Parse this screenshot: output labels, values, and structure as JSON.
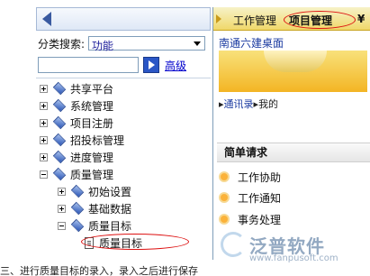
{
  "left_panel": {
    "search_label": "分类搜索:",
    "category_value": "功能",
    "keyword_value": "",
    "advanced_label": "高级",
    "tree": [
      {
        "label": "共享平台",
        "level": 0,
        "expand": "plus",
        "icon": "folder-icon"
      },
      {
        "label": "系统管理",
        "level": 0,
        "expand": "plus",
        "icon": "folder-icon"
      },
      {
        "label": "项目注册",
        "level": 0,
        "expand": "plus",
        "icon": "folder-icon"
      },
      {
        "label": "招投标管理",
        "level": 0,
        "expand": "plus",
        "icon": "folder-icon"
      },
      {
        "label": "进度管理",
        "level": 0,
        "expand": "plus",
        "icon": "folder-icon"
      },
      {
        "label": "质量管理",
        "level": 0,
        "expand": "minus",
        "icon": "folder-icon"
      },
      {
        "label": "初始设置",
        "level": 1,
        "expand": "plus",
        "icon": "folder-icon"
      },
      {
        "label": "基础数据",
        "level": 1,
        "expand": "plus",
        "icon": "folder-icon"
      },
      {
        "label": "质量目标",
        "level": 1,
        "expand": "minus",
        "icon": "folder-icon"
      },
      {
        "label": "质量目标",
        "level": 2,
        "expand": "none",
        "icon": "document-icon"
      }
    ]
  },
  "right_panel": {
    "tabs": [
      "工作管理",
      "项目管理"
    ],
    "tab_more": "¥",
    "desktop_title": "南通六建桌面",
    "contacts_link": "通讯录",
    "contacts_rest": "我的",
    "simple_request_title": "简单请求",
    "simple_items": [
      "工作协助",
      "工作通知",
      "事务处理"
    ]
  },
  "watermark": {
    "brand": "泛普软件",
    "url": "www.fanpusoft.com"
  },
  "caption": "三、进行质量目标的录入，录入之后进行保存"
}
